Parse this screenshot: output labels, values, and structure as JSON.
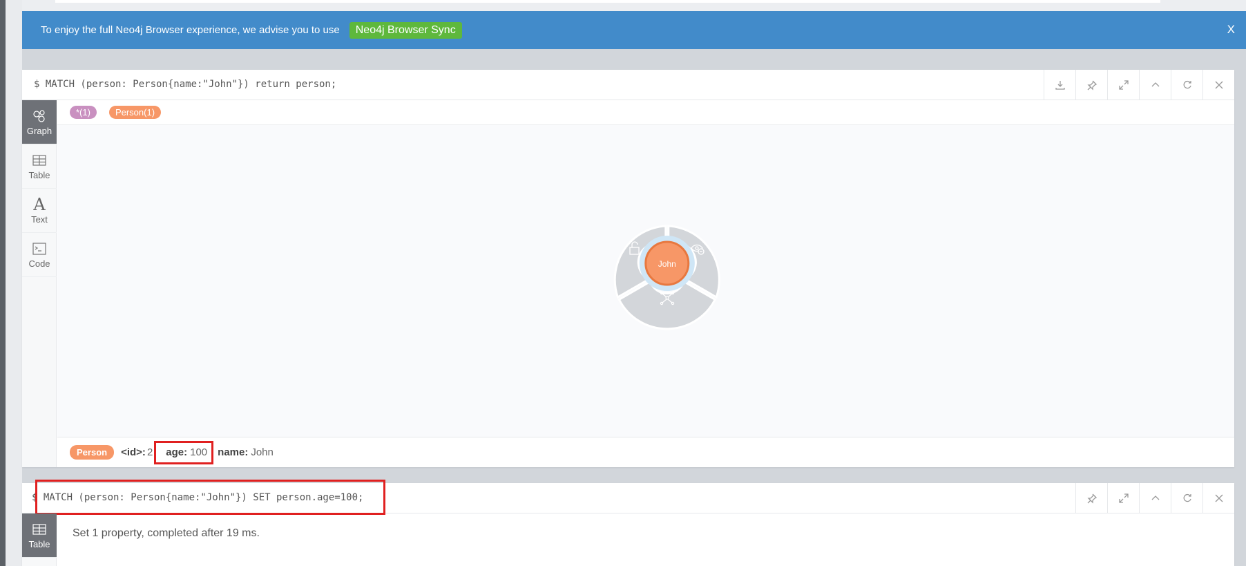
{
  "banner": {
    "text": "To enjoy the full Neo4j Browser experience, we advise you to use",
    "sync_label": "Neo4j Browser Sync",
    "close_label": "X",
    "color": "#428bca",
    "sync_color": "#5eb83c"
  },
  "frame1": {
    "command": "$ MATCH (person: Person{name:\"John\"}) return person;",
    "actions": [
      "download-icon",
      "pin-icon",
      "expand-icon",
      "collapse-icon",
      "rerun-icon",
      "close-icon"
    ],
    "tabs": [
      {
        "label": "Graph",
        "icon": "graph-icon",
        "active": true
      },
      {
        "label": "Table",
        "icon": "table-icon",
        "active": false
      },
      {
        "label": "Text",
        "icon": "text-icon",
        "active": false
      },
      {
        "label": "Code",
        "icon": "code-icon",
        "active": false
      }
    ],
    "labels": {
      "all_nodes": "*(1)",
      "person": "Person(1)"
    },
    "node": {
      "caption": "John",
      "color": "#f79767"
    },
    "status": {
      "label": "Person",
      "id_key": "<id>:",
      "id_value": "2",
      "age_key": "age:",
      "age_value": "100",
      "name_key": "name:",
      "name_value": "John"
    }
  },
  "frame2": {
    "command": "$ MATCH (person: Person{name:\"John\"}) SET person.age=100;",
    "actions": [
      "pin-icon",
      "expand-icon",
      "collapse-icon",
      "rerun-icon",
      "close-icon"
    ],
    "tab": {
      "label": "Table",
      "icon": "table-icon"
    },
    "result": "Set 1 property, completed after 19 ms."
  }
}
